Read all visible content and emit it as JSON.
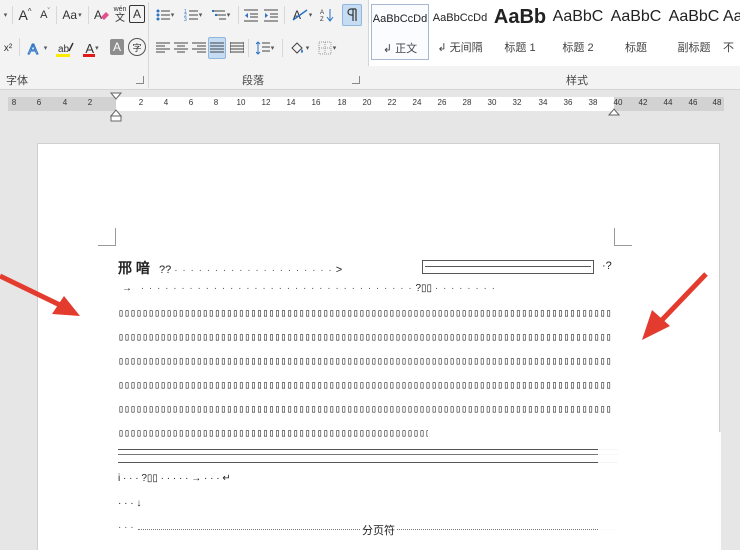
{
  "ribbon": {
    "font_group_label": "字体",
    "paragraph_group_label": "段落",
    "styles_group_label": "样式",
    "font_buttons": {
      "change_case": "Aa",
      "superscript": "x²",
      "pinyin": "wén",
      "char_border": "A",
      "char_shading": "A",
      "enclose": "字"
    },
    "styles": [
      {
        "preview": "AaBbCcDd",
        "name": "↲ 正文",
        "active": true
      },
      {
        "preview": "AaBbCcDd",
        "name": "↲ 无间隔",
        "active": false
      },
      {
        "preview": "AaBb",
        "name": "标题 1",
        "active": false
      },
      {
        "preview": "AaBbC",
        "name": "标题 2",
        "active": false
      },
      {
        "preview": "AaBbC",
        "name": "标题",
        "active": false
      },
      {
        "preview": "AaBbC",
        "name": "副标题",
        "active": false
      },
      {
        "preview": "Aa",
        "name": "不",
        "active": false
      }
    ],
    "colors": {
      "highlight": "#ffeb00",
      "font_color": "#e11a1a",
      "accent": "#2b579a"
    }
  },
  "ruler": {
    "left_ticks": [
      "8",
      "6",
      "4",
      "2"
    ],
    "right_ticks": [
      "2",
      "4",
      "6",
      "8",
      "10",
      "12",
      "14",
      "16",
      "18",
      "20",
      "22",
      "24",
      "26",
      "28",
      "30",
      "32",
      "34",
      "36",
      "38",
      "40",
      "42",
      "44",
      "46",
      "48"
    ]
  },
  "document": {
    "heading_chars": "邢  喑",
    "heading_qq": "??",
    "heading_end": "> ",
    "heading_tail": "·?",
    "line2_arrow": "→",
    "line2_marker": "?▯▯",
    "garbled_row": "▯▯▯▯▯▯▯▯▯▯▯▯▯▯▯▯▯▯▯▯▯▯▯▯▯▯▯▯▯▯▯▯▯▯▯▯▯▯▯▯▯▯▯▯▯▯▯▯▯▯▯▯▯▯▯▯▯▯▯▯▯▯▯▯▯▯▯▯▯▯▯▯▯▯▯▯▯▯▯▯▯▯",
    "garbled_last": "▯▯▯▯▯▯▯▯▯▯▯▯▯▯▯▯▯▯▯▯▯▯▯▯▯▯▯▯▯▯▯▯▯▯▯▯▯▯▯▯▯▯▯▯▯▯▯▯▯▯▯▯▯▯▯▯▯▯▯▯▯?▯▯?▯▯",
    "line_i": "i · · · ?▯▯ · · · · ·  →  · · · ↵",
    "line_dots": "· · · ↓",
    "page_break": "分页符",
    "page_break_dots": "· · ·"
  }
}
